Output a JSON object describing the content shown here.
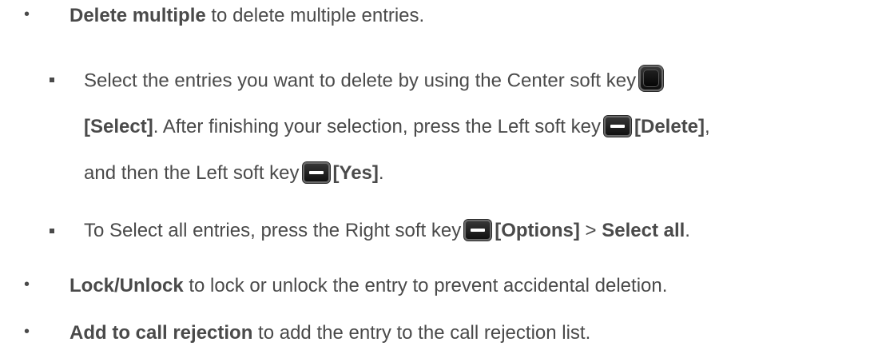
{
  "items": [
    {
      "bold": "Delete multiple",
      "text": " to delete multiple entries."
    },
    {
      "sub_items": [
        {
          "l1_text": "Select the entries you want to delete by using the Center soft key",
          "l2_select": "[Select]",
          "l2_text": ". After finishing your selection, press the Left soft key",
          "l2_delete": "[Delete]",
          "l2_comma": ",",
          "l3_text": "and then the Left soft key",
          "l3_yes": "[Yes]",
          "l3_period": "."
        },
        {
          "text": "To Select all entries, press the Right soft key",
          "options": "[Options]",
          "gt": " > ",
          "select_all": "Select all",
          "period": "."
        }
      ]
    },
    {
      "bold": "Lock/Unlock",
      "text": " to lock or unlock the entry to prevent accidental deletion."
    },
    {
      "bold": "Add to call rejection",
      "text": " to add the entry to the call rejection list."
    }
  ],
  "icons": {
    "bullet": "•",
    "center_key": "center-soft-key-icon",
    "left_key": "left-soft-key-icon",
    "right_key": "right-soft-key-icon"
  }
}
